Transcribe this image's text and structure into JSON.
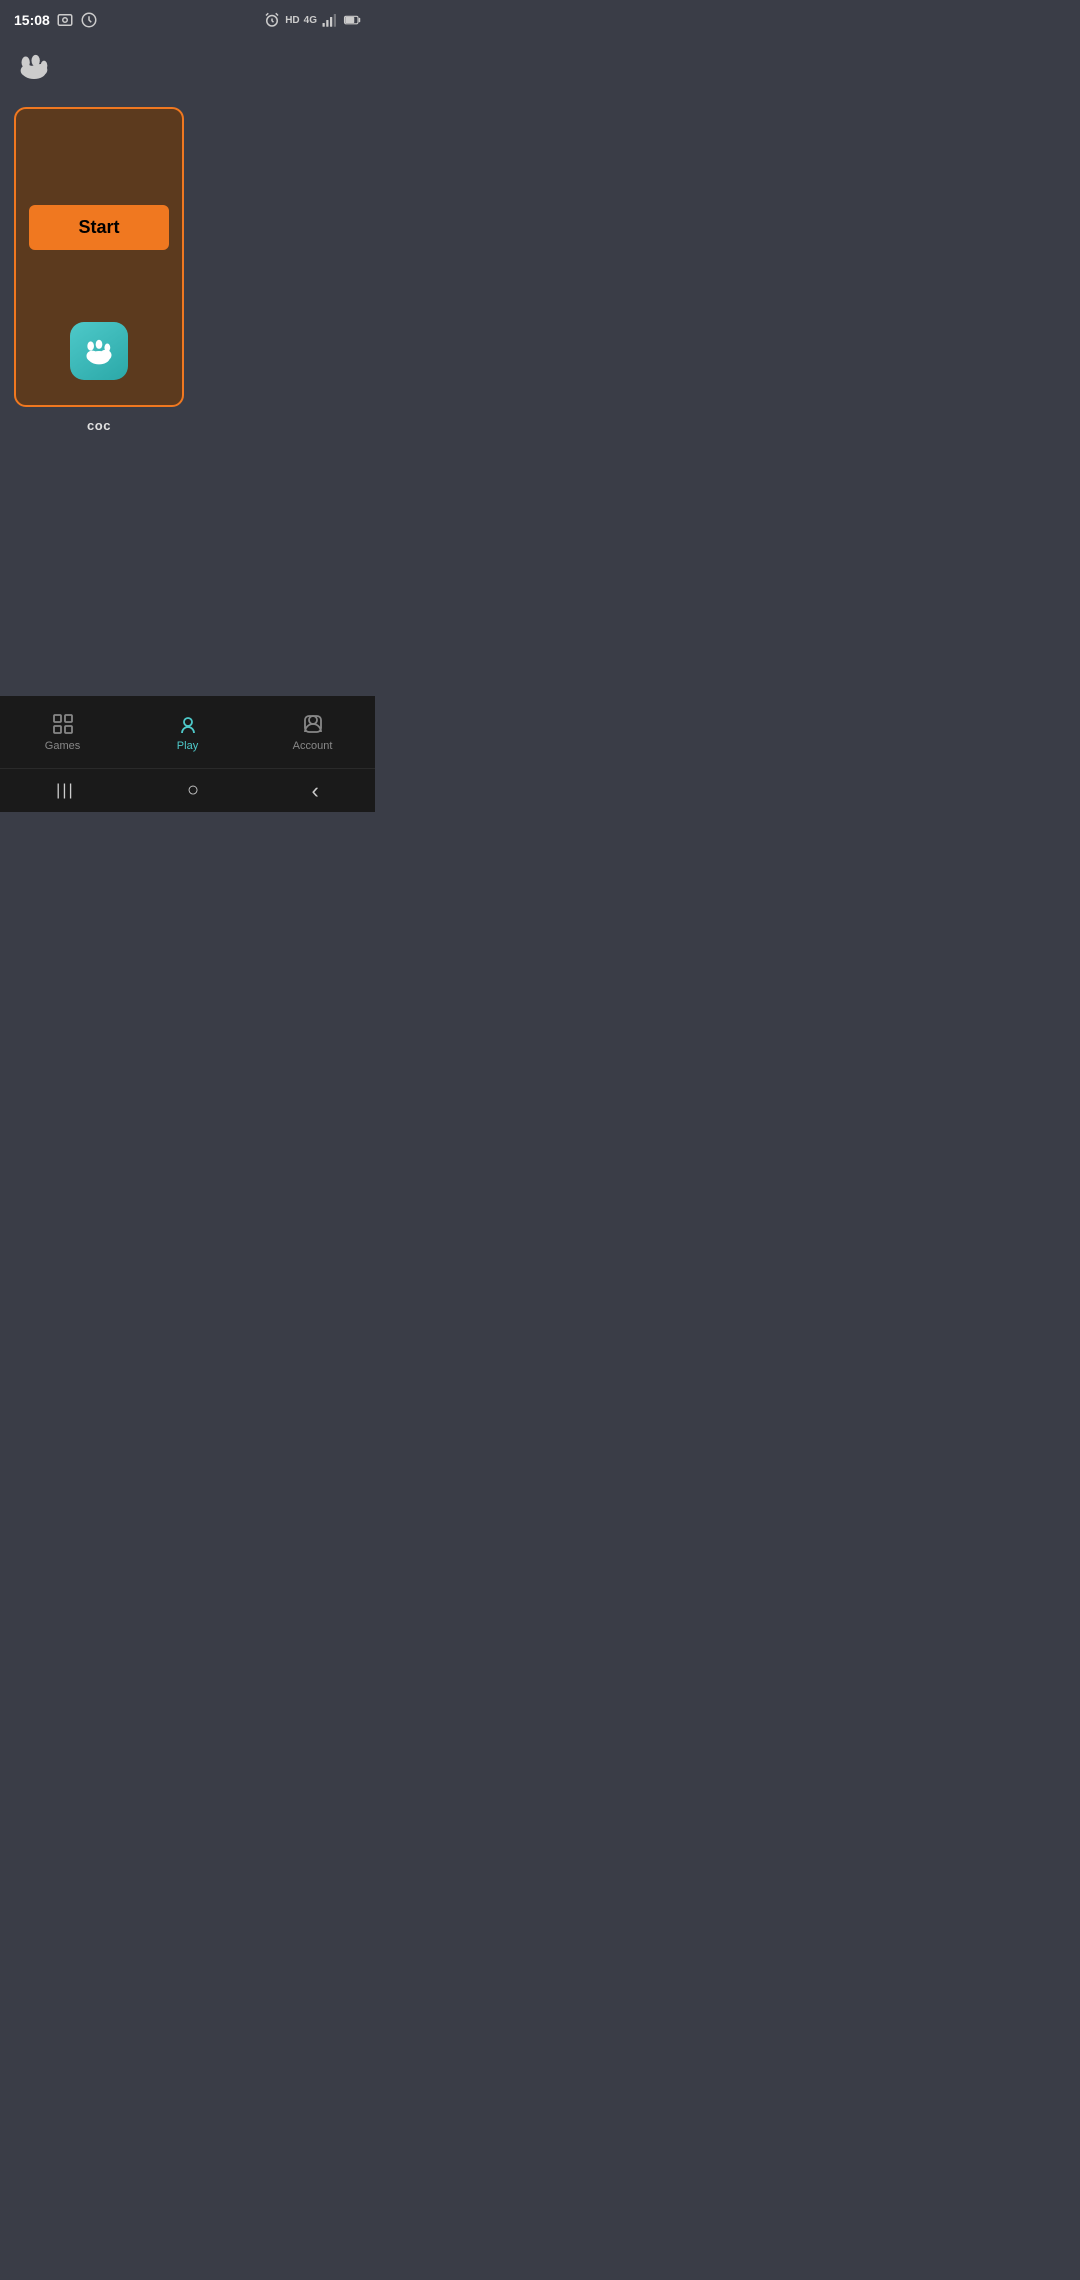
{
  "statusBar": {
    "time": "15:08",
    "icons_left": [
      "photo-icon",
      "clock-icon"
    ],
    "icons_right": [
      "alarm-icon",
      "hd-label",
      "4g-icon",
      "signal-icon",
      "battery-icon"
    ],
    "hd_label": "HD",
    "4g_label": "4G"
  },
  "topLogo": {
    "icon": "paw-cloud-icon"
  },
  "gameCard": {
    "startButton": "Start",
    "appLabel": "coc",
    "appIcon": "paw-cloud-teal-icon"
  },
  "bottomNav": {
    "items": [
      {
        "id": "games",
        "label": "Games",
        "active": false
      },
      {
        "id": "play",
        "label": "Play",
        "active": true
      },
      {
        "id": "account",
        "label": "Account",
        "active": false
      }
    ]
  },
  "systemNav": {
    "back": "‹",
    "home": "○",
    "recents": "|||"
  }
}
